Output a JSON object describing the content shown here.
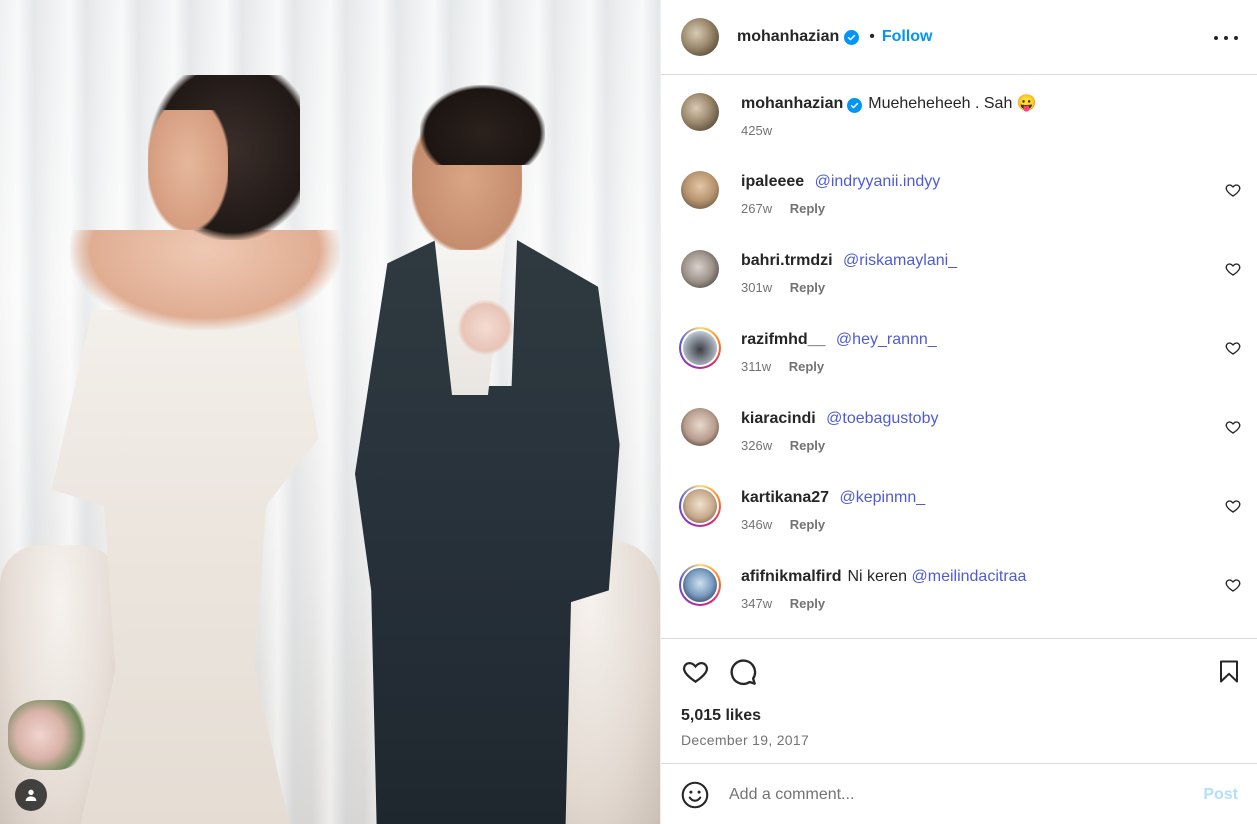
{
  "post": {
    "owner": {
      "username": "mohanhazian",
      "follow_label": "Follow",
      "separator": "•"
    },
    "caption": {
      "username": "mohanhazian",
      "text": "Mueheheheeh . Sah",
      "emoji": "😛",
      "time": "425w"
    },
    "comments": [
      {
        "username": "ipaleeee",
        "text": "",
        "mention": "@indryyanii.indyy",
        "time": "267w",
        "reply_label": "Reply",
        "story_ring": false
      },
      {
        "username": "bahri.trmdzi",
        "text": "",
        "mention": "@riskamaylani_",
        "time": "301w",
        "reply_label": "Reply",
        "story_ring": false
      },
      {
        "username": "razifmhd__",
        "text": "",
        "mention": "@hey_rannn_",
        "time": "311w",
        "reply_label": "Reply",
        "story_ring": true
      },
      {
        "username": "kiaracindi",
        "text": "",
        "mention": "@toebagustoby",
        "time": "326w",
        "reply_label": "Reply",
        "story_ring": false
      },
      {
        "username": "kartikana27",
        "text": "",
        "mention": "@kepinmn_",
        "time": "346w",
        "reply_label": "Reply",
        "story_ring": true
      },
      {
        "username": "afifnikmalfird",
        "text": "Ni keren",
        "mention": "@meilindacitraa",
        "time": "347w",
        "reply_label": "Reply",
        "story_ring": true
      }
    ],
    "likes_text": "5,015 likes",
    "date": "December 19, 2017",
    "add_comment": {
      "placeholder": "Add a comment...",
      "post_label": "Post"
    }
  },
  "icons": {
    "verified": "verified-badge-icon",
    "more": "more-options-icon",
    "like": "heart-icon",
    "comment": "comment-bubble-icon",
    "save": "bookmark-icon",
    "emoji": "emoji-smile-icon",
    "user_tag": "user-tag-icon"
  },
  "colors": {
    "accent": "#0095f6",
    "mention": "#4f5bd5",
    "muted": "#737373",
    "post_disabled": "#b2dffc"
  }
}
